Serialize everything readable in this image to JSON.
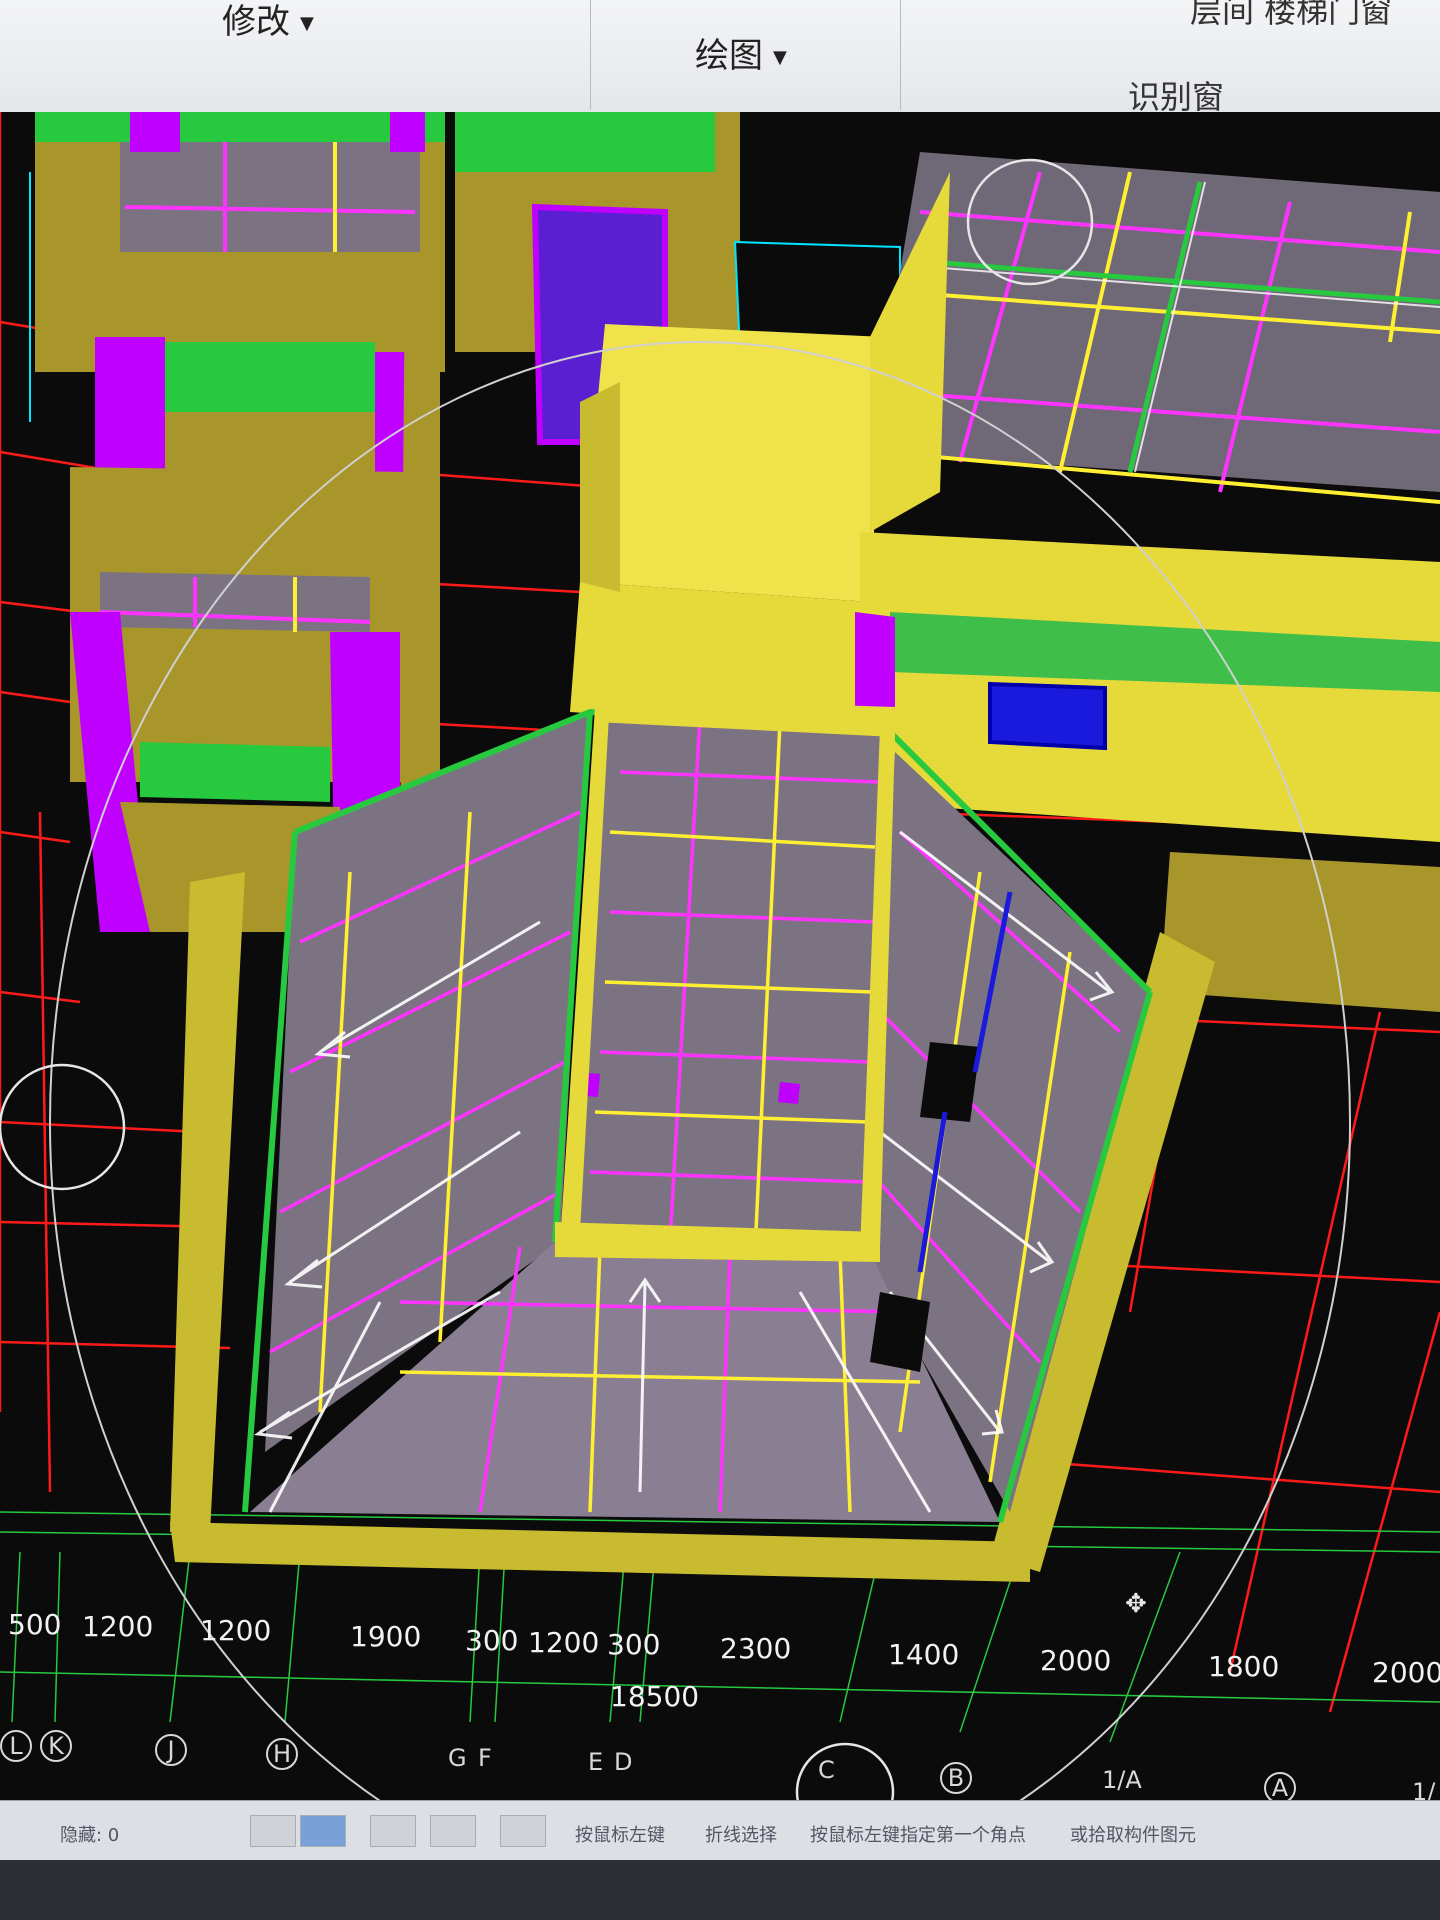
{
  "ribbon": {
    "modify_label": "修改",
    "draw_label": "绘图",
    "identify_title": "识别窗",
    "top_right_clipped": "层间 楼梯门窗"
  },
  "dimensions": {
    "segments": [
      "500",
      "1200",
      "1200",
      "1900",
      "300",
      "1200",
      "300",
      "2300",
      "1400",
      "2000",
      "1800",
      "2000"
    ],
    "total": "18500"
  },
  "axes": [
    "L",
    "K",
    "J",
    "H",
    "G",
    "F",
    "E",
    "D",
    "C",
    "B",
    "1/A",
    "A",
    "1/"
  ],
  "statusbar": {
    "hidden_label": "隐藏: 0",
    "hints": [
      "按鼠标左键",
      "折线选择",
      "按鼠标左键指定第一个角点",
      "或拾取构件图元"
    ]
  },
  "colors": {
    "background": "#0b0b0b",
    "grid_red": "#ff1a1a",
    "grid_green": "#27c93f",
    "wall_yellow": "#e6d93a",
    "wall_olive": "#a8962a",
    "magenta": "#c000ff",
    "rebar_magenta": "#ff33ff",
    "rebar_yellow": "#ffef33",
    "slab_gray": "#7b7382"
  },
  "icons": {
    "nav_cube": "compass-icon",
    "dropdown": "chevron-down-icon"
  }
}
